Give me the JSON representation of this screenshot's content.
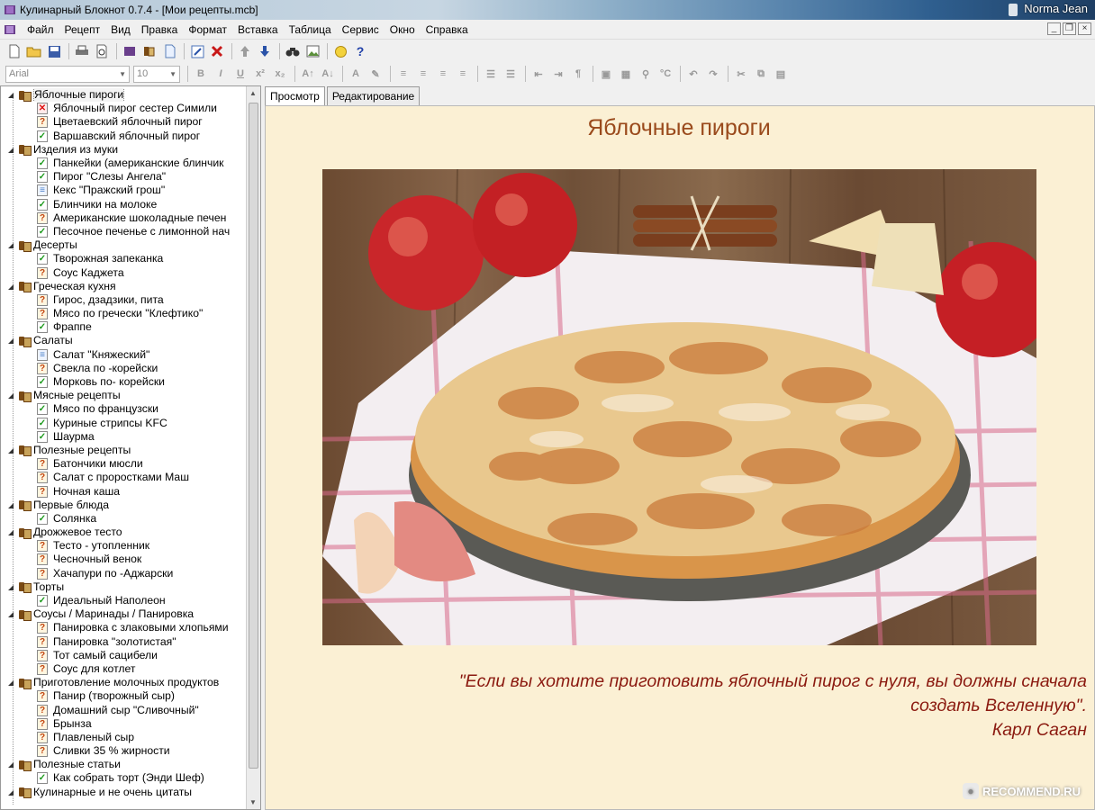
{
  "window": {
    "title": "Кулинарный Блокнот 0.7.4 - [Мои рецепты.mcb]",
    "user": "Norma Jean"
  },
  "menu": [
    "Файл",
    "Рецепт",
    "Вид",
    "Правка",
    "Формат",
    "Вставка",
    "Таблица",
    "Сервис",
    "Окно",
    "Справка"
  ],
  "format_bar": {
    "font": "Arial",
    "size": "10"
  },
  "tabs": [
    "Просмотр",
    "Редактирование"
  ],
  "tree": [
    {
      "label": "Яблочные пироги",
      "selected": true,
      "items": [
        {
          "label": "Яблочный пирог сестер Симили",
          "status": "x"
        },
        {
          "label": "Цветаевский яблочный пирог",
          "status": "q"
        },
        {
          "label": "Варшавский яблочный пирог",
          "status": "ok"
        }
      ]
    },
    {
      "label": "Изделия из муки",
      "items": [
        {
          "label": "Панкейки (американские блинчик",
          "status": "ok"
        },
        {
          "label": "Пирог \"Слезы Ангела\"",
          "status": "ok"
        },
        {
          "label": "Кекс \"Пражский грош\"",
          "status": "doc"
        },
        {
          "label": "Блинчики на молоке",
          "status": "ok"
        },
        {
          "label": "Американские шоколадные печен",
          "status": "q"
        },
        {
          "label": "Песочное печенье с лимонной нач",
          "status": "ok"
        }
      ]
    },
    {
      "label": "Десерты",
      "items": [
        {
          "label": "Творожная запеканка",
          "status": "ok"
        },
        {
          "label": "Соус Каджета",
          "status": "q"
        }
      ]
    },
    {
      "label": "Греческая кухня",
      "items": [
        {
          "label": "Гирос, дзадзики, пита",
          "status": "q"
        },
        {
          "label": "Мясо по гречески \"Клефтико\"",
          "status": "q"
        },
        {
          "label": "Фраппе",
          "status": "ok"
        }
      ]
    },
    {
      "label": "Салаты",
      "items": [
        {
          "label": "Салат \"Княжеский\"",
          "status": "doc"
        },
        {
          "label": "Свекла по -корейски",
          "status": "q"
        },
        {
          "label": "Морковь по- корейски",
          "status": "ok"
        }
      ]
    },
    {
      "label": "Мясные рецепты",
      "items": [
        {
          "label": "Мясо по французски",
          "status": "ok"
        },
        {
          "label": "Куриные стрипсы KFC",
          "status": "ok"
        },
        {
          "label": "Шаурма",
          "status": "ok"
        }
      ]
    },
    {
      "label": "Полезные рецепты",
      "items": [
        {
          "label": "Батончики мюсли",
          "status": "q"
        },
        {
          "label": "Салат с проростками Маш",
          "status": "q"
        },
        {
          "label": "Ночная каша",
          "status": "q"
        }
      ]
    },
    {
      "label": "Первые блюда",
      "items": [
        {
          "label": "Солянка",
          "status": "ok"
        }
      ]
    },
    {
      "label": "Дрожжевое тесто",
      "items": [
        {
          "label": "Тесто - утопленник",
          "status": "q"
        },
        {
          "label": "Чесночный венок",
          "status": "q"
        },
        {
          "label": "Хачапури по -Аджарски",
          "status": "q"
        }
      ]
    },
    {
      "label": "Торты",
      "items": [
        {
          "label": "Идеальный Наполеон",
          "status": "ok"
        }
      ]
    },
    {
      "label": "Соусы / Маринады / Панировка",
      "items": [
        {
          "label": "Панировка с злаковыми хлопьями",
          "status": "q"
        },
        {
          "label": "Панировка \"золотистая\"",
          "status": "q"
        },
        {
          "label": "Тот самый сацибели",
          "status": "q"
        },
        {
          "label": "Соус для котлет",
          "status": "q"
        }
      ]
    },
    {
      "label": "Приготовление молочных продуктов",
      "items": [
        {
          "label": "Панир (творожный сыр)",
          "status": "q"
        },
        {
          "label": "Домашний сыр \"Сливочный\"",
          "status": "q"
        },
        {
          "label": "Брынза",
          "status": "q"
        },
        {
          "label": "Плавленый сыр",
          "status": "q"
        },
        {
          "label": "Сливки 35 % жирности",
          "status": "q"
        }
      ]
    },
    {
      "label": "Полезные статьи",
      "items": [
        {
          "label": "Как собрать торт (Энди Шеф)",
          "status": "ok"
        }
      ]
    },
    {
      "label": "Кулинарные и не очень цитаты",
      "items": []
    }
  ],
  "page": {
    "title": "Яблочные пироги",
    "quote_line1": "\"Если вы хотите приготовить яблочный пирог с нуля, вы должны сначала",
    "quote_line2": "создать Вселенную\".",
    "quote_author": "Карл Саган"
  },
  "watermark": "RECOMMEND.RU",
  "colors": {
    "page_bg": "#fbf0d4",
    "title": "#9a4a1c",
    "quote": "#8b1a10"
  }
}
